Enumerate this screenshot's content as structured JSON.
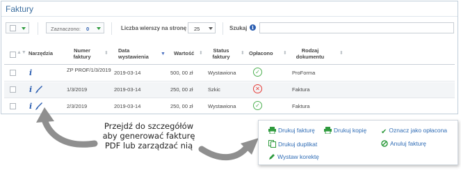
{
  "panel": {
    "title": "Faktury"
  },
  "toolbar": {
    "selected_label": "Zaznaczono:",
    "selected_count": "0",
    "rows_label": "Liczba wierszy na stronę",
    "rows_value": "25",
    "search_label": "Szukaj",
    "search_value": ""
  },
  "table": {
    "headers": {
      "tools": "Narzędzia",
      "number": "Numer faktury",
      "date": "Data wystawienia",
      "value": "Wartość",
      "status": "Status faktury",
      "paid": "Opłacono",
      "type": "Rodzaj dokumentu"
    },
    "rows": [
      {
        "number": "ZP PROF/1/3/2019",
        "date": "2019-03-14",
        "value": "500, 00 zł",
        "status": "Wystawiona",
        "paid": true,
        "type": "ProForma"
      },
      {
        "number": "1/3/2019",
        "date": "2019-03-14",
        "value": "250, 00 zł",
        "status": "Szkic",
        "paid": false,
        "type": "Faktura"
      },
      {
        "number": "2/3/2019",
        "date": "2019-03-14",
        "value": "250, 00 zł",
        "status": "Wystawiona",
        "paid": true,
        "type": "Faktura"
      }
    ]
  },
  "note": {
    "lines": [
      "Przejdź do szczegółów",
      "aby generować fakturę",
      "PDF lub zarządzać nią"
    ]
  },
  "actions": {
    "print_invoice": "Drukuj fakturę",
    "print_copy": "Drukuj kopię",
    "print_duplicate": "Drukuj duplikat",
    "issue_correction": "Wystaw korektę",
    "mark_paid": "Oznacz jako opłacona",
    "cancel_invoice": "Anuluj fakturę"
  },
  "colors": {
    "accent": "#3c6e9f",
    "link": "#2f6cb5",
    "green": "#2e9a3d",
    "red": "#e53935",
    "paid_ok": "#4caf50"
  }
}
